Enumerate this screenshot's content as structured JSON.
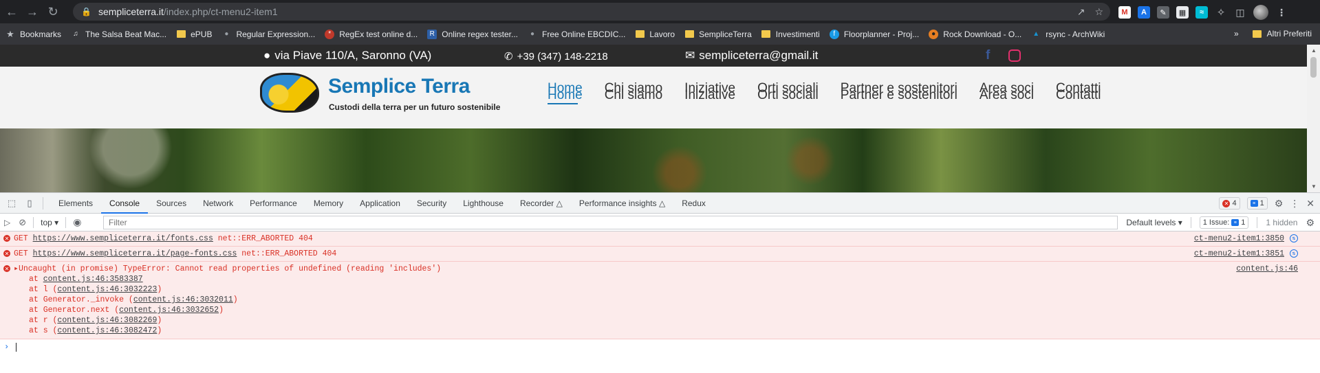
{
  "browser": {
    "url_host": "sempliceterra.it",
    "url_path": "/index.php/ct-menu2-item1",
    "bookmarks": [
      {
        "label": "Bookmarks",
        "icon": "star-icon"
      },
      {
        "label": "The Salsa Beat Mac...",
        "icon": "music-icon"
      },
      {
        "label": "ePUB",
        "icon": "folder-icon"
      },
      {
        "label": "Regular Expression...",
        "icon": "globe-icon"
      },
      {
        "label": "RegEx test online d...",
        "icon": "regex-icon"
      },
      {
        "label": "Online regex tester...",
        "icon": "r-icon"
      },
      {
        "label": "Free Online EBCDIC...",
        "icon": "globe-icon"
      },
      {
        "label": "Lavoro",
        "icon": "folder-icon"
      },
      {
        "label": "SempliceTerra",
        "icon": "folder-icon"
      },
      {
        "label": "Investimenti",
        "icon": "folder-icon"
      },
      {
        "label": "Floorplanner - Proj...",
        "icon": "floorplanner-icon"
      },
      {
        "label": "Rock Download - O...",
        "icon": "rock-icon"
      },
      {
        "label": "rsync - ArchWiki",
        "icon": "archwiki-icon"
      }
    ],
    "other_bookmarks": "Altri Preferiti"
  },
  "site": {
    "address": "via Piave 110/A, Saronno (VA)",
    "phone": "+39 (347) 148-2218",
    "email": "sempliceterra@gmail.it",
    "logo_title": "Semplice Terra",
    "logo_subtitle": "Custodi della terra per un futuro sostenibile",
    "menu": [
      "Home",
      "Chi siamo",
      "Iniziative",
      "Orti sociali",
      "Partner e sostenitori",
      "Area soci",
      "Contatti"
    ]
  },
  "devtools": {
    "tabs": [
      "Elements",
      "Console",
      "Sources",
      "Network",
      "Performance",
      "Memory",
      "Application",
      "Security",
      "Lighthouse",
      "Recorder",
      "Performance insights",
      "Redux"
    ],
    "active_tab": "Console",
    "error_count": "4",
    "message_count": "1",
    "context": "top",
    "filter_placeholder": "Filter",
    "levels": "Default levels",
    "issues_label": "1 Issue:",
    "issues_count": "1",
    "hidden": "1 hidden",
    "messages": [
      {
        "prefix": "GET ",
        "url": "https://www.sempliceterra.it/fonts.css",
        "suffix": " net::ERR_ABORTED 404",
        "source": "ct-menu2-item1:3850"
      },
      {
        "prefix": "GET ",
        "url": "https://www.sempliceterra.it/page-fonts.css",
        "suffix": " net::ERR_ABORTED 404",
        "source": "ct-menu2-item1:3851"
      }
    ],
    "uncaught": {
      "text": "Uncaught (in promise) TypeError: Cannot read properties of undefined (reading 'includes')",
      "source": "content.js:46",
      "stack": [
        {
          "pre": "at ",
          "link": "content.js:46:3583387",
          "post": ""
        },
        {
          "pre": "at l (",
          "link": "content.js:46:3032223",
          "post": ")"
        },
        {
          "pre": "at Generator._invoke (",
          "link": "content.js:46:3032011",
          "post": ")"
        },
        {
          "pre": "at Generator.next (",
          "link": "content.js:46:3032652",
          "post": ")"
        },
        {
          "pre": "at r (",
          "link": "content.js:46:3082269",
          "post": ")"
        },
        {
          "pre": "at s (",
          "link": "content.js:46:3082472",
          "post": ")"
        }
      ]
    }
  }
}
